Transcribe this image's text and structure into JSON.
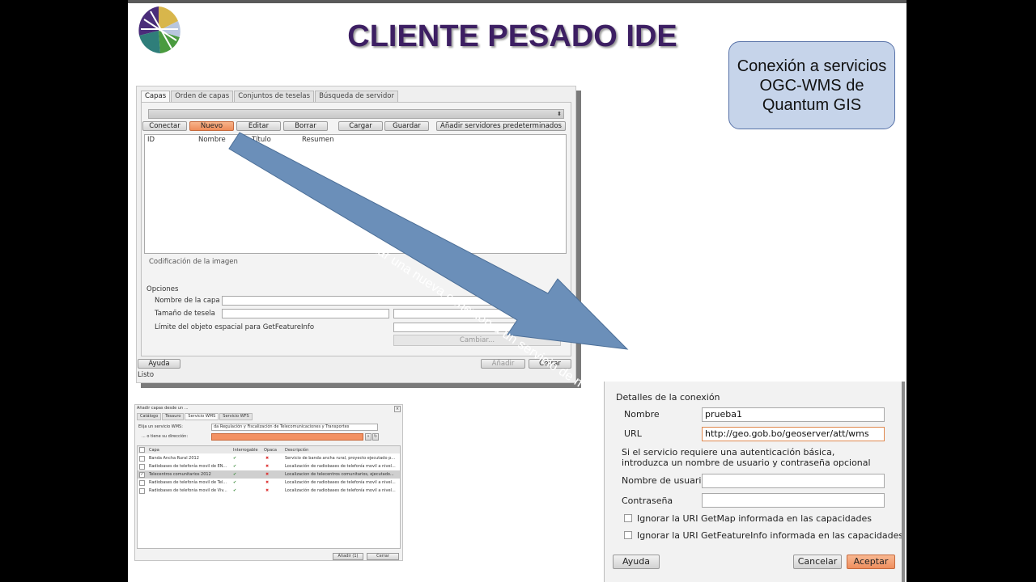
{
  "title": "CLIENTE PESADO IDE",
  "callout": "Conexión a servicios OGC-WMS de Quantum GIS",
  "arrow_text": "Realizar una nueva conexión a un servicio de mapas WMS",
  "colors": {
    "title": "#3d1f63",
    "callout_fill": "#c6d4ea",
    "arrow": "#6b8fb9",
    "highlight_button": "#ee8c5a"
  },
  "wms_dialog": {
    "tabs": [
      "Capas",
      "Orden de capas",
      "Conjuntos de teselas",
      "Búsqueda de servidor"
    ],
    "buttons": {
      "connect": "Conectar",
      "new": "Nuevo",
      "edit": "Editar",
      "delete": "Borrar",
      "load": "Cargar",
      "save": "Guardar",
      "add_default": "Añadir servidores predeterminados"
    },
    "columns": [
      "ID",
      "Nombre",
      "Título",
      "Resumen"
    ],
    "image_encoding": "Codificación de la imagen",
    "options_label": "Opciones",
    "layer_name_label": "Nombre de la capa",
    "tile_size_label": "Tamaño de tesela",
    "feature_limit_label": "Límite del objeto espacial para GetFeatureInfo",
    "change_button": "Cambiar...",
    "help_button": "Ayuda",
    "add_button": "Añadir",
    "close_button": "Cerrar",
    "status": "Listo"
  },
  "add_dialog": {
    "title": "Añadir capas desde un ...",
    "tabs": [
      "Catálogo",
      "Tesauro",
      "Servicio WMS",
      "Servicio WFS"
    ],
    "choose_label": "Elija un servicio WMS:",
    "choose_value": "da Regulación y Fiscalización de Telecomunicaciones y Transportes",
    "address_label": "... o tiene su dirección:",
    "columns": [
      "Capa",
      "Interrogable",
      "Opaca",
      "Descripción"
    ],
    "rows": [
      {
        "name": "Banda Ancha Rural 2012",
        "desc": "Servicio de banda ancha rural, proyecto ejecutado p...",
        "checked": false,
        "selected": false
      },
      {
        "name": "Radiobases de telefonía movil de EN...",
        "desc": "Localización de radiobases de telefonía movil a nivel...",
        "checked": false,
        "selected": false
      },
      {
        "name": "Telecentros comunitarios 2012",
        "desc": "Localizacion de telecentros comunitarios, ejecutado...",
        "checked": true,
        "selected": true
      },
      {
        "name": "Radiobases de telefonía movil de Tel...",
        "desc": "Localización de radiobases de telefonía movil a nivel...",
        "checked": false,
        "selected": false
      },
      {
        "name": "Radiobases de telefonia movil de Viv...",
        "desc": "Localización de radiobases de telefonía movil a nivel...",
        "checked": false,
        "selected": false
      }
    ],
    "add_button": "Añadir (1)",
    "close_button": "Cerrar"
  },
  "connection_dialog": {
    "header": "Detalles de la conexión",
    "name_label": "Nombre",
    "name_value": "prueba1",
    "url_label": "URL",
    "url_value": "http://geo.gob.bo/geoserver/att/wms",
    "auth_note": "Si el servicio requiere una autenticación básica, introduzca un nombre de usuario y contraseña opcional",
    "user_label": "Nombre de usuario",
    "password_label": "Contraseña",
    "ignore_getmap": "Ignorar la URI GetMap informada en las capacidades",
    "ignore_getfeatureinfo": "Ignorar la URI GetFeatureInfo informada en las capacidades",
    "help_button": "Ayuda",
    "cancel_button": "Cancelar",
    "accept_button": "Aceptar"
  }
}
